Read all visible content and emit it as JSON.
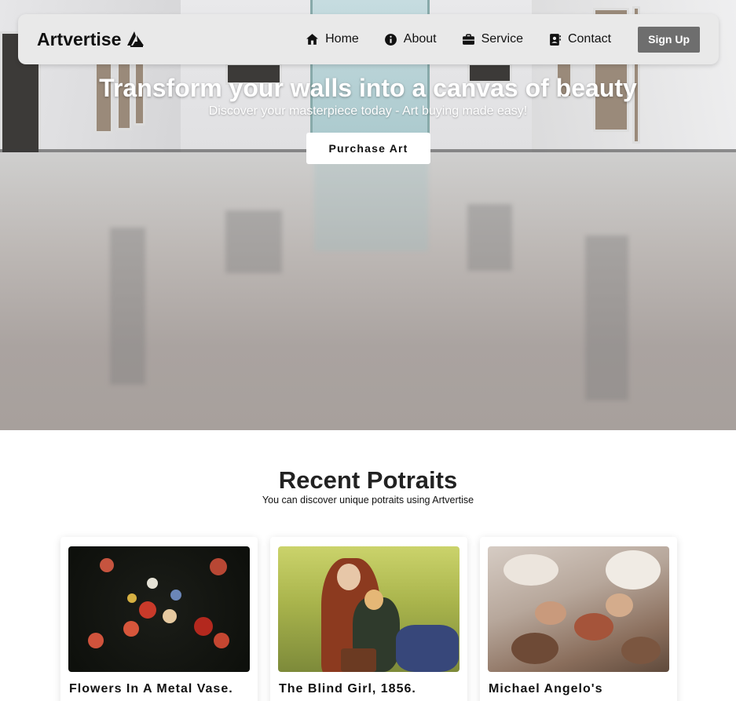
{
  "nav": {
    "brand": "Artvertise",
    "items": [
      {
        "label": "Home",
        "icon": "home-icon"
      },
      {
        "label": "About",
        "icon": "info-icon"
      },
      {
        "label": "Service",
        "icon": "briefcase-icon"
      },
      {
        "label": "Contact",
        "icon": "contact-card-icon"
      }
    ],
    "signup_label": "Sign Up"
  },
  "hero": {
    "title": "Transform your walls into a canvas of beauty",
    "subtitle": "Discover your masterpiece today - Art buying made easy!",
    "cta_label": "Purchase Art"
  },
  "recent": {
    "title": "Recent Potraits",
    "subtitle": "You can discover unique potraits using Artvertise",
    "cards": [
      {
        "caption": "Flowers In A Metal Vase."
      },
      {
        "caption": "The Blind Girl, 1856."
      },
      {
        "caption": "Michael Angelo's"
      }
    ]
  },
  "colors": {
    "navbar_bg": "#e9e9e9",
    "signup_bg": "#6e6e6e",
    "hero_text": "#ffffff"
  }
}
